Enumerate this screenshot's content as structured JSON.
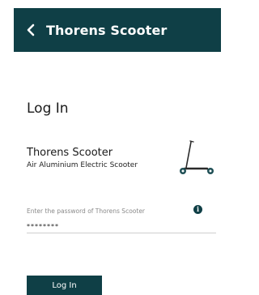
{
  "header": {
    "title": "Thorens Scooter",
    "back_icon": "chevron-left-icon"
  },
  "page": {
    "title": "Log In"
  },
  "device": {
    "name": "Thorens Scooter",
    "description": "Air Aluminium Electric Scooter",
    "image_icon": "scooter-icon"
  },
  "password": {
    "label": "Enter the password of Thorens Scooter",
    "value": "********",
    "info_icon": "info-icon"
  },
  "actions": {
    "login_label": "Log In"
  },
  "colors": {
    "brand": "#0f3f46",
    "background": "#ffffff"
  }
}
